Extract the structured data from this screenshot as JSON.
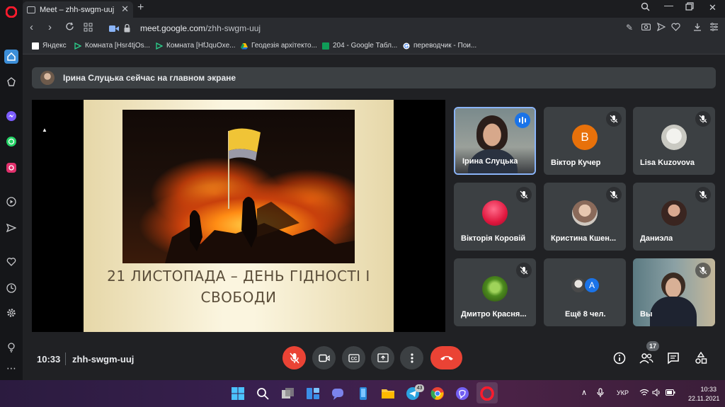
{
  "browser": {
    "tab_title": "Meet – zhh-swgm-uuj",
    "url_domain": "meet.google.com",
    "url_path": "/zhh-swgm-uuj"
  },
  "bookmarks": [
    {
      "label": "Яндекс",
      "icon": "yandex-icon"
    },
    {
      "label": "Комната [Hsr4tjOs...",
      "icon": "play-triangle-icon"
    },
    {
      "label": "Комната [HfJquOxe...",
      "icon": "play-triangle-icon"
    },
    {
      "label": "Геодезія архітекто...",
      "icon": "google-drive-icon"
    },
    {
      "label": "204 - Google Табл...",
      "icon": "google-sheets-icon"
    },
    {
      "label": "переводчик - Пои...",
      "icon": "google-g-icon"
    }
  ],
  "meet": {
    "banner_text": "Ірина Слуцька сейчас на главном экране",
    "slide_title": "21 ЛИСТОПАДА – ДЕНЬ ГІДНОСТІ І СВОБОДИ",
    "participants": [
      {
        "name": "Ірина Слуцька",
        "state": "speaking"
      },
      {
        "name": "Віктор Кучер",
        "avatar_letter": "B",
        "avatar_color": "#e8710a",
        "state": "muted"
      },
      {
        "name": "Lisa Kuzovova",
        "state": "muted"
      },
      {
        "name": "Вікторія Коровій",
        "state": "muted"
      },
      {
        "name": "Кристина Кшен...",
        "state": "muted"
      },
      {
        "name": "Даниэла",
        "state": "muted"
      },
      {
        "name": "Дмитро Красня...",
        "state": "muted"
      },
      {
        "name": "Ещё 8 чел.",
        "avatar_letter": "A",
        "avatar_color": "#1a73e8"
      },
      {
        "name": "Вы",
        "state": "muted"
      }
    ],
    "time": "10:33",
    "meeting_code": "zhh-swgm-uuj",
    "participant_count": "17"
  },
  "taskbar": {
    "language": "УКР",
    "clock_time": "10:33",
    "clock_date": "22.11.2021",
    "telegram_badge": "43"
  },
  "colors": {
    "accent_blue": "#8ab4f8",
    "end_call_red": "#ea4335",
    "tile_bg": "#3c4043"
  }
}
